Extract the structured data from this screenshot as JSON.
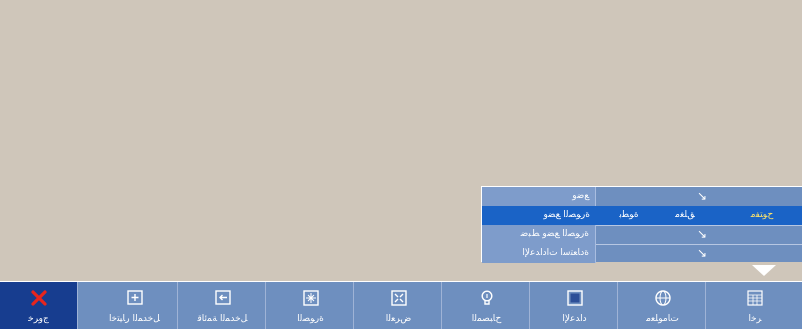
{
  "submenu": {
    "rows": [
      {
        "label": "ﻊﺿﻭ",
        "options": [],
        "has_arrow": true
      },
      {
        "label": "ﺓﺭﻮﺼﻟﺍ ﻊﻀﻭ",
        "options": [
          "ﺓﻮﻄﺑ",
          "ﻖﻠﻐﻣ",
          "ﺡﻮﺘﻔﻣ"
        ],
        "selected": "ﺡﻮﺘﻔﻣ",
        "has_arrow": false
      },
      {
        "label": "ﺓﺭﻮﺼﻟﺍ ﻊﻀﻭ ﻂﺒﺿ",
        "options": [],
        "has_arrow": true
      },
      {
        "label": "ﺓﺩﺎﻌﺘﺳﺍ ﺕﺍﺩﺍﺪﻋﻹﺍ",
        "options": [],
        "has_arrow": true
      }
    ]
  },
  "bar": {
    "items": [
      {
        "label": "ﺝﻭﺮﺧ",
        "icon": "close-x-icon"
      },
      {
        "label": "ﻞﺧﺪﻤﻟﺍ ﺭﺎﻴﺘﺧﺍ",
        "icon": "input-select-icon"
      },
      {
        "label": "ﻞﺧﺪﻤﻟﺍ ﺔﻤﺋﺎﻗ",
        "icon": "input-list-icon"
      },
      {
        "label": "ﺓﺭﻮﺼﻟﺍ",
        "icon": "picture-icon"
      },
      {
        "label": "ﺽﺮﻌﻟﺍ",
        "icon": "display-icon"
      },
      {
        "label": "ﺡﺎﺒﺼﻤﻟﺍ",
        "icon": "lamp-icon"
      },
      {
        "label": "ﺩﺍﺪﻋﻹﺍ",
        "icon": "setup-icon"
      },
      {
        "label": "ﺕﺎﻣﻮﻠﻌﻣ",
        "icon": "globe-info-icon"
      },
      {
        "label": "ﺮﺧﺁ",
        "icon": "other-icon"
      }
    ]
  },
  "colors": {
    "background": "#cfc6ba",
    "bar": "#6e8fbf",
    "active_row": "#1a63c6",
    "exit_tile": "#173d8f",
    "selected_option": "#ffe46a",
    "exit_icon": "#e8251d"
  }
}
